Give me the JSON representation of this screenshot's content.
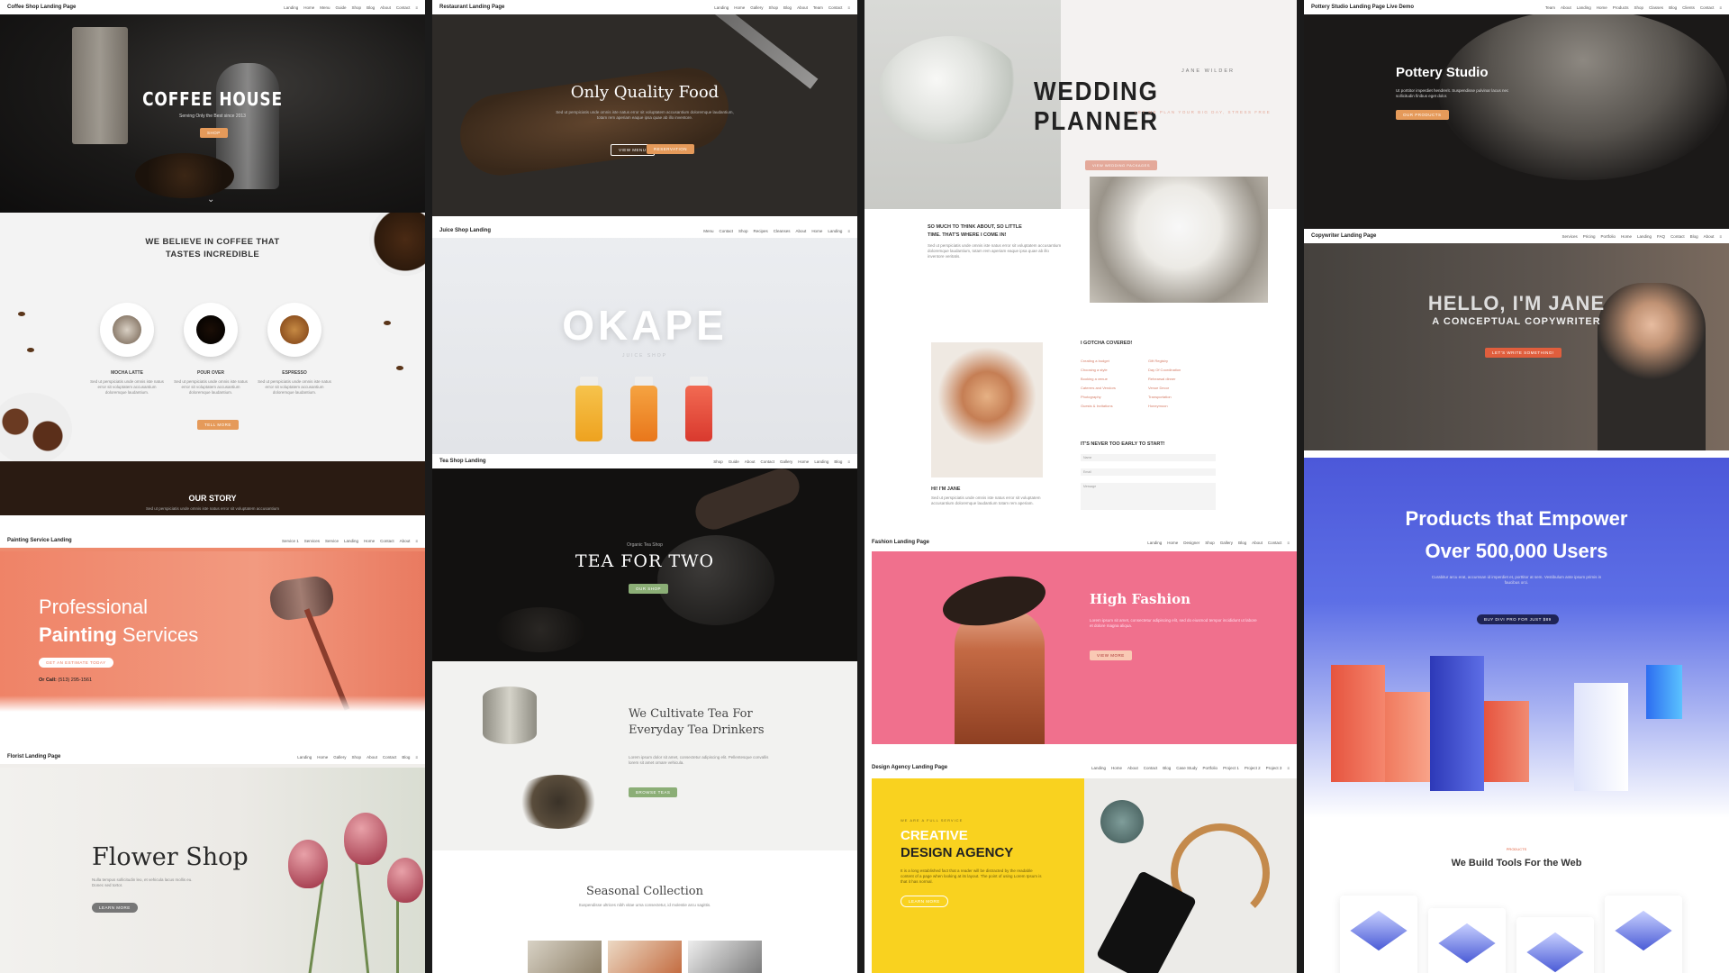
{
  "coffee": {
    "brand": "Coffee Shop Landing Page",
    "nav": [
      "Landing",
      "Home",
      "Menu",
      "Guide",
      "Shop",
      "Blog",
      "About",
      "Contact",
      "≡"
    ],
    "hero_title": "COFFEE HOUSE",
    "hero_sub": "Serving Only the Best since 2013",
    "hero_btn": "SHOP",
    "believe_title": "WE BELIEVE IN COFFEE THAT TASTES INCREDIBLE",
    "lorem": "Sed ut perspiciatis unde omnis iste natus error sit voluptatem accusantium doloremque laudantium.",
    "cups": [
      "MOCHA LATTE",
      "POUR OVER",
      "ESPRESSO"
    ],
    "believe_btn": "TELL MORE",
    "story_title": "OUR STORY",
    "story_text": "Sed ut perspiciatis unde omnis iste natus error sit voluptatem accusantium"
  },
  "painting": {
    "brand": "Painting Service Landing",
    "nav": [
      "Service 1",
      "Services",
      "Service",
      "Landing",
      "Home",
      "Contact",
      "About",
      "≡"
    ],
    "title_line1": "Professional",
    "title_bold": "Painting",
    "title_rest": " Services",
    "btn": "GET AN ESTIMATE TODAY",
    "call_label": "Or Call:",
    "phone": "(513) 295-1561"
  },
  "floral": {
    "brand": "Florist Landing Page",
    "nav": [
      "Landing",
      "Home",
      "Gallery",
      "Shop",
      "About",
      "Contact",
      "Blog",
      "≡"
    ],
    "title": "Flower Shop",
    "text": "Nulla tempus sollicitudin leo, et vehicula lacus mollis eu. Donec sed tortor.",
    "btn": "LEARN MORE"
  },
  "restaurant": {
    "brand": "Restaurant Landing Page",
    "nav": [
      "Landing",
      "Home",
      "Gallery",
      "Shop",
      "Blog",
      "About",
      "Team",
      "Contact",
      "≡"
    ],
    "title": "Only Quality Food",
    "text": "Sed ut perspiciatis unde omnis iste natus error sit voluptatem accusantium doloremque laudantium, totam rem aperiam eaque ipsa quae ab illo inventore.",
    "btn1": "VIEW MENU",
    "btn2": "RESERVATION"
  },
  "juice": {
    "brand": "Juice Shop Landing",
    "nav": [
      "Menu",
      "Contact",
      "Shop",
      "Recipes",
      "Cleanses",
      "About",
      "Home",
      "Landing",
      "≡"
    ],
    "title": "OKAPE",
    "sub": "JUICE SHOP"
  },
  "tea": {
    "brand": "Tea Shop Landing",
    "nav": [
      "Shop",
      "Guide",
      "About",
      "Contact",
      "Gallery",
      "Home",
      "Landing",
      "Blog",
      "≡"
    ],
    "small": "Organic Tea Shop",
    "title": "TEA FOR TWO",
    "btn": "OUR SHOP",
    "cultivate_title": "We Cultivate Tea For Everyday Tea Drinkers",
    "cultivate_text": "Lorem ipsum dolor sit amet, consectetur adipiscing elit. Pellentesque convallis lorem sit amet ornare vehicula.",
    "cultivate_btn": "BROWSE TEAS",
    "seasonal_title": "Seasonal Collection",
    "seasonal_sub": "Suspendisse ultrices nibh vitae urna consectetur, id molestie arcu sagittis."
  },
  "wedding": {
    "author": "JANE WILDER",
    "title": "WEDDING PLANNER",
    "tag": "LET ME PLAN YOUR BIG DAY, STRESS FREE",
    "pkg": "VIEW WEDDING PACKAGES",
    "so_title": "SO MUCH TO THINK ABOUT, SO LITTLE TIME. THAT'S WHERE I COME IN!",
    "so_text": "Sed ut perspiciatis unde omnis iste natus error sit voluptatem accusantium doloremque laudantium, totam rem aperiam eaque ipsa quae ab illo inventore veritatis.",
    "imjane": "HI! I'M JANE",
    "jane_text": "Sed ut perspiciatis unde omnis iste natus error sit voluptatem accusantium doloremque laudantium totam rem aperiam.",
    "gotcha": "I GOTCHA COVERED!",
    "services": [
      "Creating a budget",
      "Gift Registry",
      "Choosing a style",
      "Day Of Coordination",
      "Booking a venue",
      "Rehearsal dinner",
      "Caterers and Vendors",
      "Venue Decor",
      "Photography",
      "Transportation",
      "Guests & Invitations",
      "Honeymoon"
    ],
    "never": "IT'S NEVER TOO EARLY TO START!",
    "fields": [
      "Name",
      "Email",
      "Message"
    ]
  },
  "fashion": {
    "brand": "Fashion Landing Page",
    "nav": [
      "Landing",
      "Home",
      "Designer",
      "Shop",
      "Gallery",
      "Blog",
      "About",
      "Contact",
      "≡"
    ],
    "title": "High Fashion",
    "text": "Lorem ipsum sit amet, consectetur adipiscing elit, sed do eiusmod tempor incididunt ut labore et dolore magna aliqua.",
    "btn": "VIEW MORE"
  },
  "agency": {
    "brand": "Design Agency Landing Page",
    "nav": [
      "Landing",
      "Home",
      "About",
      "Contact",
      "Blog",
      "Case Study",
      "Portfolio",
      "Project 1",
      "Project 2",
      "Project 3",
      "≡"
    ],
    "small": "WE ARE A FULL SERVICE",
    "title1": "CREATIVE",
    "title2": "DESIGN AGENCY",
    "text": "It is a long established fact that a reader will be distracted by the readable content of a page when looking at its layout. The point of using Lorem Ipsum is that it has normal.",
    "btn": "LEARN MORE"
  },
  "pottery": {
    "brand": "Pottery Studio Landing Page Live Demo",
    "nav": [
      "Team",
      "About",
      "Landing",
      "Home",
      "Products",
      "Shop",
      "Classes",
      "Blog",
      "Clients",
      "Contact",
      "≡"
    ],
    "title": "Pottery Studio",
    "text": "Ut porttitor imperdiet hendrerit. Suspendisse pulvinar lacus nec sollicitudin finibus eget dolor.",
    "btn": "OUR PRODUCTS"
  },
  "copywriter": {
    "brand": "Copywriter Landing Page",
    "nav": [
      "Services",
      "Pricing",
      "Portfolio",
      "Home",
      "Landing",
      "FAQ",
      "Contact",
      "Blog",
      "About",
      "≡"
    ],
    "title": "HELLO, I'M JANE",
    "sub": "A CONCEPTUAL COPYWRITER",
    "btn": "LET'S WRITE SOMETHING!"
  },
  "products": {
    "title": "Products that Empower Over 500,000 Users",
    "text": "Curabitur arcu erat, accumsan id imperdiet et, porttitor at sem. Vestibulum ante ipsum primis in faucibus orci.",
    "btn": "Buy Divi Pro for Just $89",
    "small": "PRODUCTS",
    "section_title": "We Build Tools For the Web"
  },
  "colors": {
    "coffee_accent": "#e59a5a",
    "painting_coral": "#ee8a6d",
    "tea_green": "#8bae76",
    "wedding_blush": "#e4a99a",
    "fashion_pink": "#f0708d",
    "agency_yellow": "#f9d21f",
    "copy_orange": "#e05e3d",
    "products_blue": "#4c58d9"
  }
}
